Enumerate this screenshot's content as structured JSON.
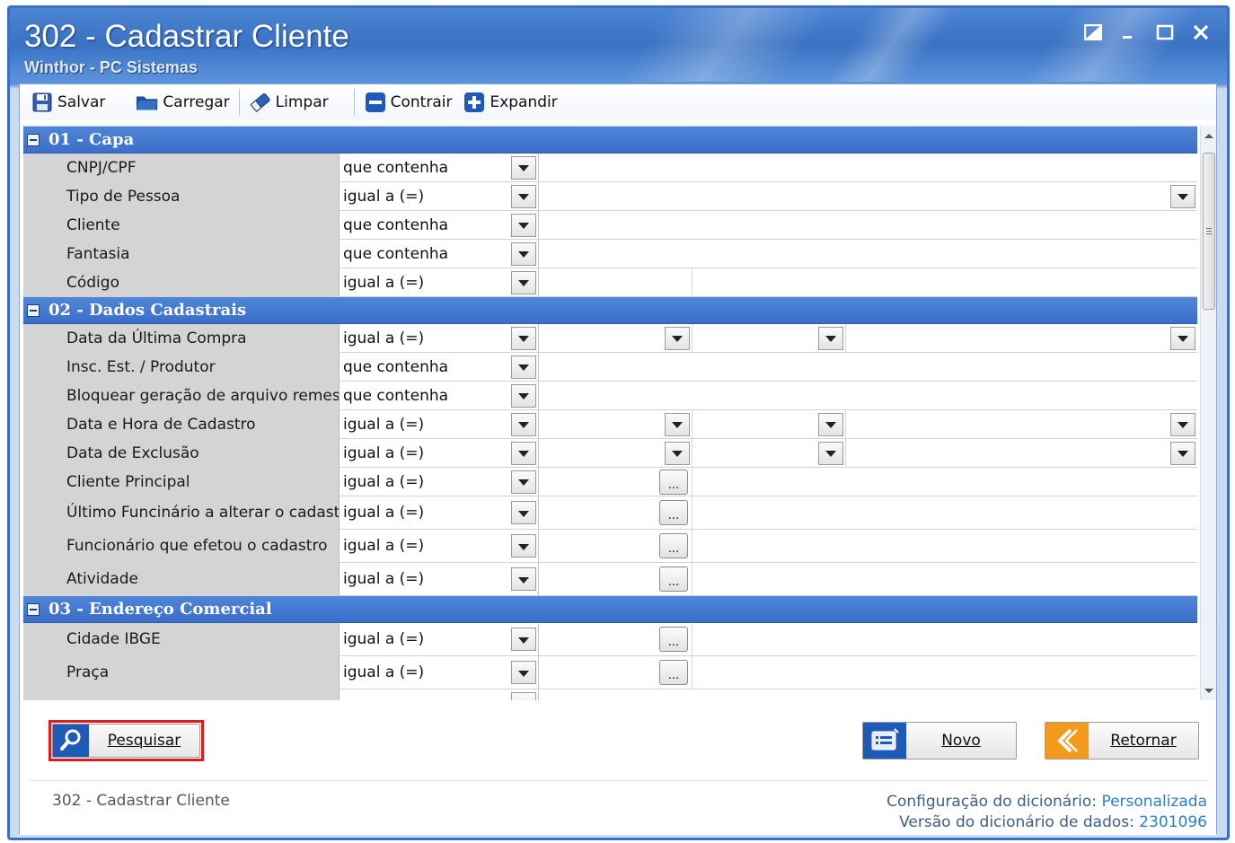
{
  "window": {
    "title": "302 - Cadastrar Cliente",
    "subtitle": "Winthor - PC Sistemas"
  },
  "toolbar": {
    "salvar": "Salvar",
    "carregar": "Carregar",
    "limpar": "Limpar",
    "contrair": "Contrair",
    "expandir": "Expandir"
  },
  "sections": [
    {
      "title": "01 - Capa",
      "rows": [
        {
          "label": "CNPJ/CPF",
          "op": "que contenha"
        },
        {
          "label": "Tipo de Pessoa",
          "op": "igual a (=)"
        },
        {
          "label": "Cliente",
          "op": "que contenha"
        },
        {
          "label": "Fantasia",
          "op": "que contenha"
        },
        {
          "label": "Código",
          "op": "igual a (=)"
        }
      ]
    },
    {
      "title": "02 - Dados Cadastrais",
      "rows": [
        {
          "label": "Data da Última Compra",
          "op": "igual a (=)"
        },
        {
          "label": "Insc. Est. / Produtor",
          "op": "que contenha"
        },
        {
          "label": "Bloquear geração de arquivo remess",
          "op": "que contenha"
        },
        {
          "label": "Data e Hora de Cadastro",
          "op": "igual a (=)"
        },
        {
          "label": "Data de Exclusão",
          "op": "igual a (=)"
        },
        {
          "label": "Cliente Principal",
          "op": "igual a (=)"
        },
        {
          "label": "Último Funcinário a alterar o cadastro",
          "op": "igual a (=)"
        },
        {
          "label": "Funcionário que efetou o cadastro",
          "op": "igual a (=)"
        },
        {
          "label": "Atividade",
          "op": "igual a (=)"
        }
      ]
    },
    {
      "title": "03 - Endereço Comercial",
      "rows": [
        {
          "label": "Cidade IBGE",
          "op": "igual a (=)"
        },
        {
          "label": "Praça",
          "op": "igual a (=)"
        }
      ]
    }
  ],
  "ellipsis": "...",
  "buttons": {
    "pesquisar": "Pesquisar",
    "novo": "Novo",
    "retornar": "Retornar"
  },
  "footer": {
    "left": "302 - Cadastrar Cliente",
    "config_label": "Configuração do dicionário:",
    "config_value": "Personalizada",
    "version_label": "Versão do dicionário de dados:",
    "version_value": "2301096"
  },
  "colors": {
    "title_blue": "#3a72c4",
    "section_blue": "#3b6ec8",
    "highlight_red": "#d81e1e",
    "footer_value_blue": "#2d7fc7"
  }
}
